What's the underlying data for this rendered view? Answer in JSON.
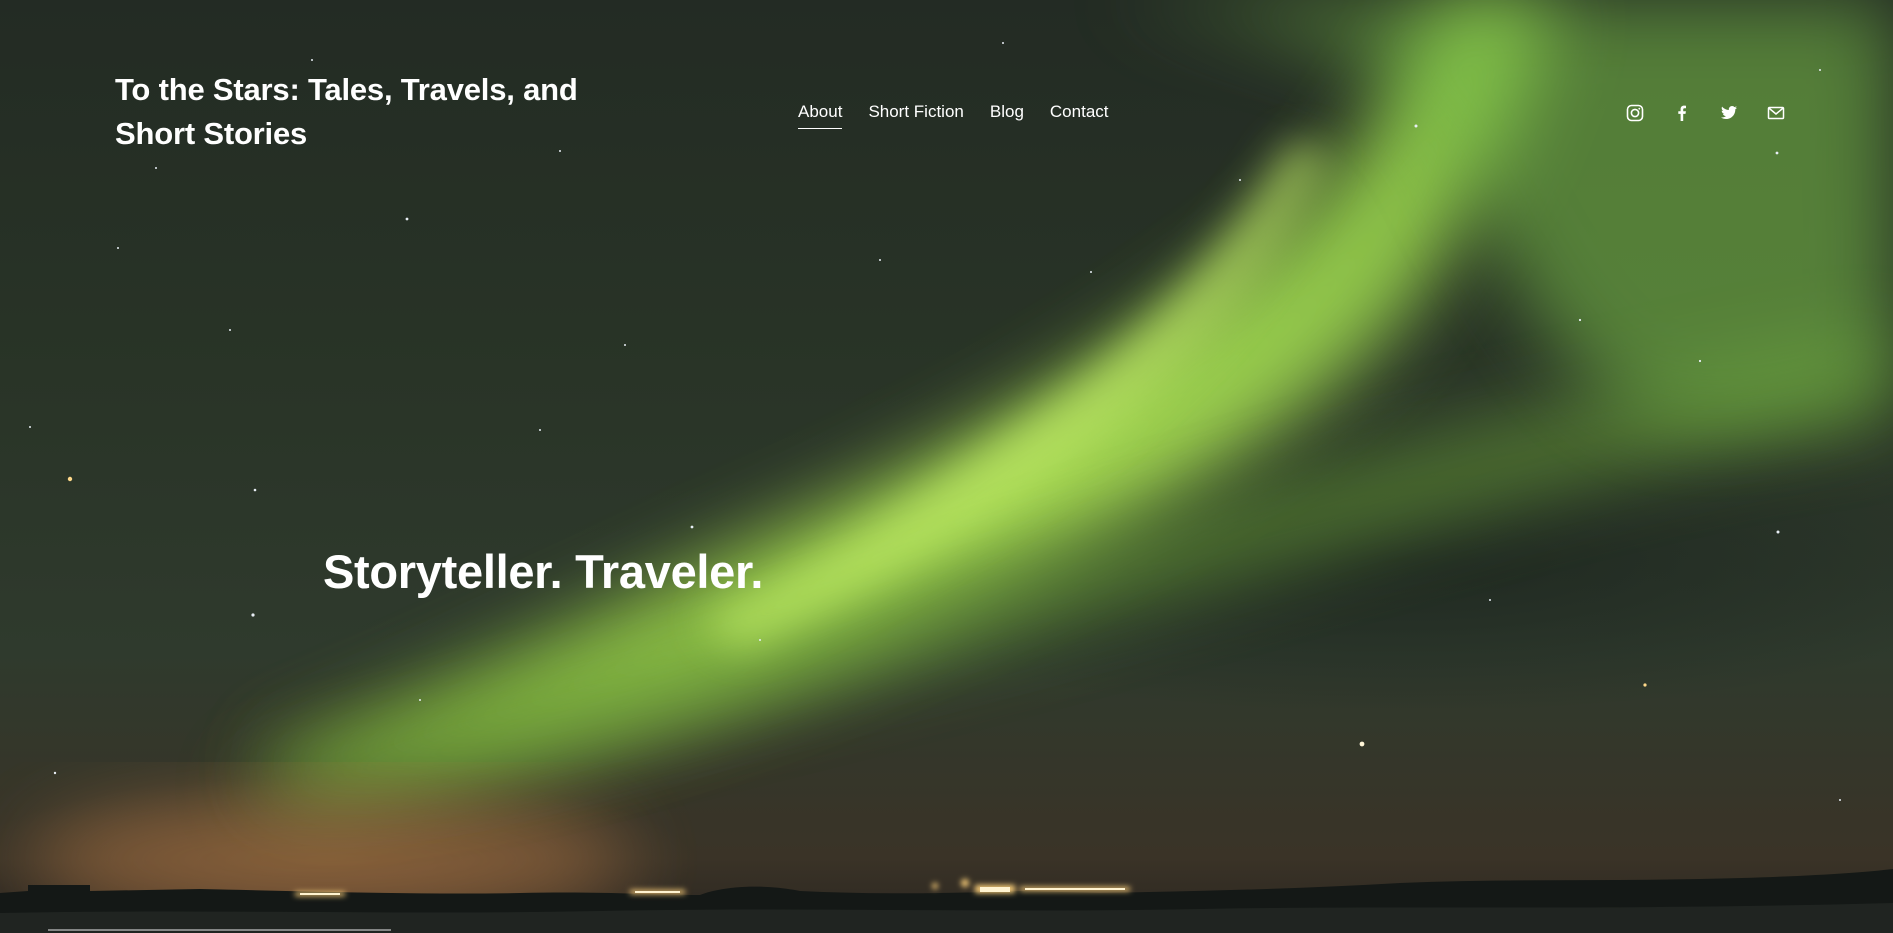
{
  "site": {
    "title": "To the Stars: Tales, Travels, and Short Stories"
  },
  "nav": {
    "items": [
      {
        "label": "About",
        "active": true
      },
      {
        "label": "Short Fiction",
        "active": false
      },
      {
        "label": "Blog",
        "active": false
      },
      {
        "label": "Contact",
        "active": false
      }
    ]
  },
  "social": {
    "icons": [
      "instagram-icon",
      "facebook-icon",
      "twitter-icon",
      "mail-icon"
    ]
  },
  "hero": {
    "tagline": "Storyteller. Traveler.",
    "background": "night sky with green aurora over a dark landscape",
    "accent_color": "#b8f25a"
  }
}
